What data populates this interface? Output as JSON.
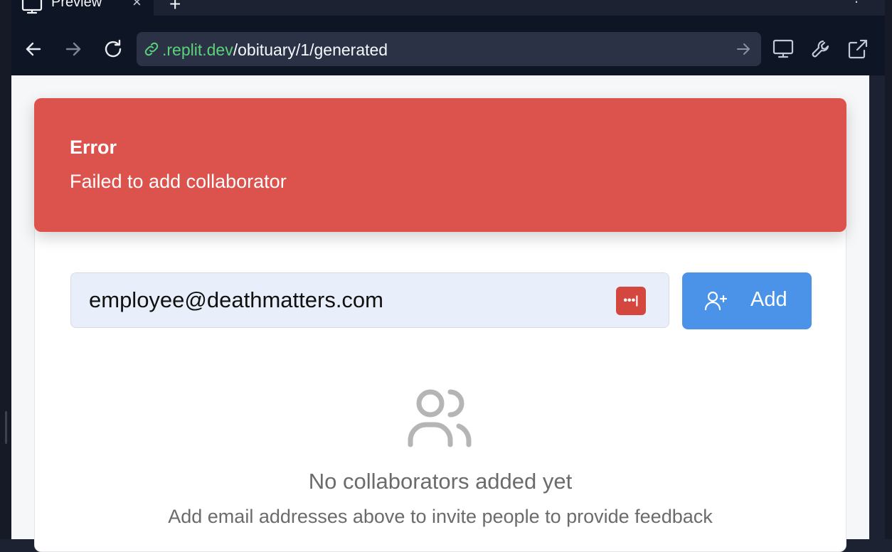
{
  "tab": {
    "title": "Preview",
    "close": "×"
  },
  "tabbar": {
    "new_tab": "+",
    "more": "⋮"
  },
  "address_bar": {
    "host": ".replit.dev",
    "path": "/obituary/1/generated"
  },
  "toast": {
    "title": "Error",
    "description": "Failed to add collaborator"
  },
  "collaborators": {
    "email_value": "employee@deathmatters.com",
    "password_manager_badge": "•••|",
    "add_button_label": "Add",
    "empty_title": "No collaborators added yet",
    "empty_subtitle": "Add email addresses above to invite people to provide feedback"
  },
  "colors": {
    "toast_bg": "#dc524c",
    "add_button_bg": "#4a93e8",
    "url_host": "#5bd27a",
    "browser_chrome": "#0e1525"
  },
  "icons": {
    "tab": "monitor-icon",
    "back": "arrow-left-icon",
    "forward": "arrow-right-icon",
    "reload": "refresh-icon",
    "link": "link-icon",
    "go": "arrow-right-icon",
    "devices": "monitor-icon",
    "devtools": "wrench-icon",
    "open_external": "external-link-icon",
    "add_user": "user-plus-icon",
    "empty": "users-icon"
  }
}
